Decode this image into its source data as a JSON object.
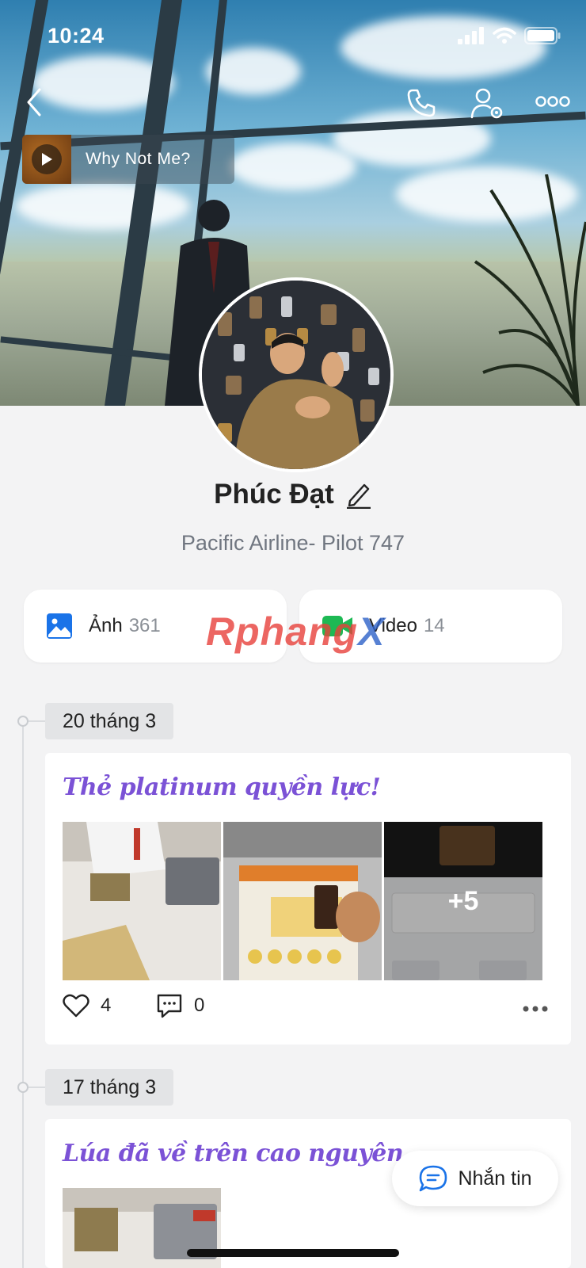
{
  "status_bar": {
    "time": "10:24"
  },
  "header": {
    "back_icon": "chevron-left-icon",
    "call_icon": "phone-icon",
    "settings_icon": "user-settings-icon",
    "more_icon": "more-horizontal-icon"
  },
  "music": {
    "title": "Why Not Me?"
  },
  "profile": {
    "name": "Phúc Đạt",
    "bio": "Pacific Airline- Pilot 747"
  },
  "media": {
    "photos": {
      "label": "Ảnh",
      "count": "361"
    },
    "videos": {
      "label": "Video",
      "count": "14"
    }
  },
  "watermark": {
    "text_main": "Rphang",
    "text_x": "X"
  },
  "posts": [
    {
      "date": "20 tháng 3",
      "title": "Thẻ platinum quyền lực!",
      "more_photos": "+5",
      "likes": "4",
      "comments": "0"
    },
    {
      "date": "17 tháng 3",
      "title": "Lúa đã về trên cao nguyên"
    }
  ],
  "chat_button": {
    "label": "Nhắn tin"
  },
  "colors": {
    "accent_purple": "#7b52d6",
    "photo_icon_blue": "#1a73e8",
    "video_icon_green": "#1db954"
  }
}
